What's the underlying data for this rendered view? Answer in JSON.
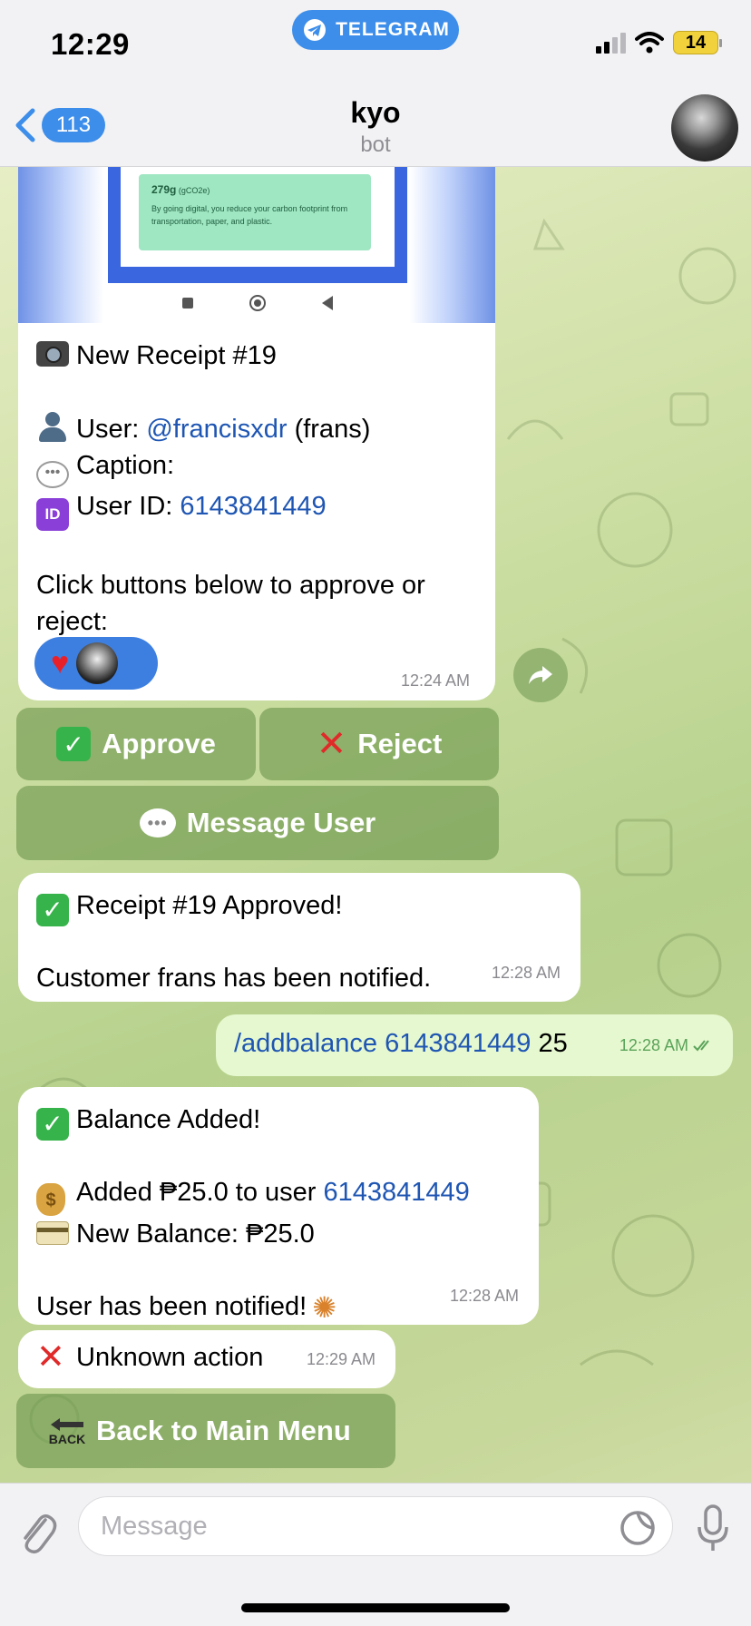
{
  "status": {
    "time": "12:29",
    "app_pill": "TELEGRAM",
    "battery": "14"
  },
  "header": {
    "back_count": "113",
    "title": "kyo",
    "subtitle": "bot"
  },
  "messages": {
    "receipt": {
      "img_amount": "279g",
      "img_unit": "(gCO2e)",
      "img_text": "By going digital, you reduce your carbon footprint from transportation, paper, and plastic.",
      "title": "New Receipt #19",
      "user_label": "User:",
      "user_handle": "@francisxdr",
      "user_name": "(frans)",
      "caption_label": "Caption:",
      "userid_label": "User ID:",
      "userid_value": "6143841449",
      "instruction": "Click buttons below to approve or reject:",
      "time": "12:24 AM"
    },
    "approved": {
      "line1": "Receipt #19 Approved!",
      "line2": "Customer frans has been notified.",
      "time": "12:28 AM"
    },
    "outgoing": {
      "command": "/addbalance",
      "user_id": "6143841449",
      "amount": "25",
      "time": "12:28 AM"
    },
    "balance": {
      "line1": "Balance Added!",
      "line2_prefix": "Added ₱25.0 to user",
      "line2_user": "6143841449",
      "line3": "New Balance: ₱25.0",
      "line4": "User has been notified!",
      "time": "12:28 AM"
    },
    "unknown": {
      "text": "Unknown action",
      "time": "12:29 AM"
    }
  },
  "keyboard": {
    "approve": "Approve",
    "reject": "Reject",
    "message_user": "Message User",
    "back_main": "Back to Main Menu",
    "back_icon_text": "BACK"
  },
  "input": {
    "placeholder": "Message"
  },
  "colors": {
    "accent": "#3d8eea",
    "link": "#1f56b3",
    "keyboard_button": "#6c964c"
  }
}
